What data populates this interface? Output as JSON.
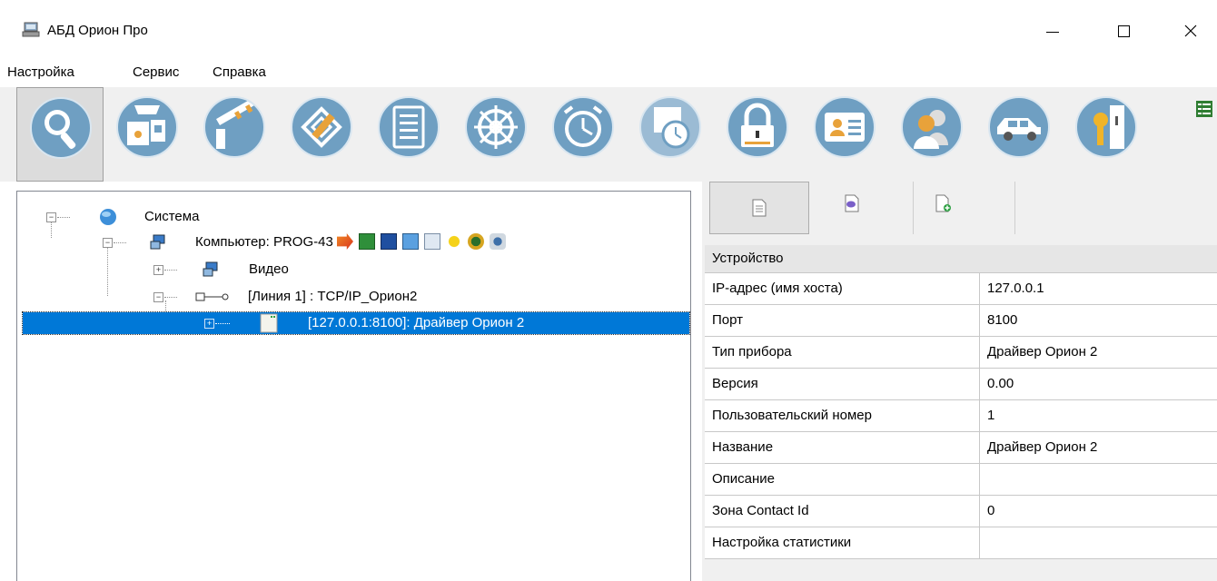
{
  "window": {
    "title": "АБД Орион Про",
    "minimize_glyph": "—",
    "maximize_glyph": "☐",
    "close_glyph": "✕"
  },
  "menu": {
    "items": [
      "Настройка",
      "Сервис",
      "Справка"
    ]
  },
  "toolbar": {
    "buttons": [
      {
        "icon": "search-icon",
        "active": true
      },
      {
        "icon": "devices-icon"
      },
      {
        "icon": "barrier-icon"
      },
      {
        "icon": "plan-edit-icon"
      },
      {
        "icon": "list-icon"
      },
      {
        "icon": "wheel-icon"
      },
      {
        "icon": "alarm-clock-icon"
      },
      {
        "icon": "schedule-icon"
      },
      {
        "icon": "lock-icon"
      },
      {
        "icon": "id-card-icon"
      },
      {
        "icon": "users-icon"
      },
      {
        "icon": "car-icon"
      },
      {
        "icon": "key-icon"
      },
      {
        "icon": "grid-view-icon"
      }
    ]
  },
  "tree": {
    "system_label": "Система",
    "computer_label": "Компьютер: PROG-43",
    "video_label": "Видео",
    "line_label": "[Линия 1] : TCP/IP_Орион2",
    "driver_label": "[127.0.0.1:8100]: Драйвер Орион 2"
  },
  "properties": {
    "section_label": "Устройство",
    "rows": [
      {
        "name": "IP-адрес (имя хоста)",
        "value": "127.0.0.1"
      },
      {
        "name": "Порт",
        "value": "8100"
      },
      {
        "name": "Тип прибора",
        "value": "Драйвер Орион 2"
      },
      {
        "name": "Версия",
        "value": "0.00"
      },
      {
        "name": "Пользовательский номер",
        "value": "1"
      },
      {
        "name": "Название",
        "value": "Драйвер Орион 2"
      },
      {
        "name": "Описание",
        "value": ""
      },
      {
        "name": "Зона Contact Id",
        "value": "0"
      },
      {
        "name": "Настройка статистики",
        "value": ""
      }
    ]
  },
  "colors": {
    "selection": "#0078d7",
    "toolbar_icon": "#6f9fc2"
  }
}
